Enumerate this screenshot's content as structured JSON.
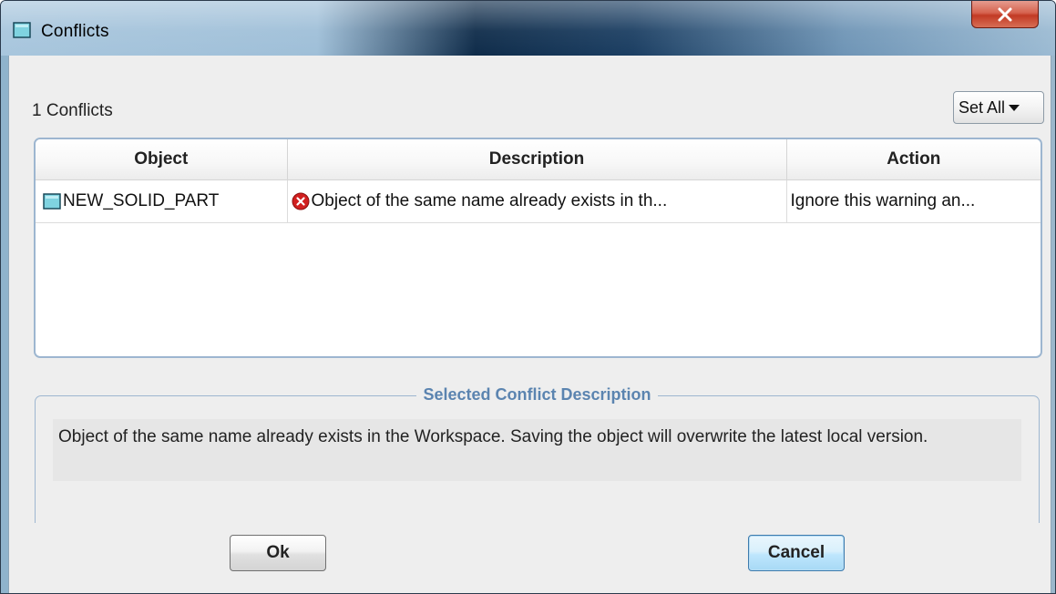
{
  "window": {
    "title": "Conflicts",
    "close_label": "X"
  },
  "header": {
    "count_label": "1 Conflicts",
    "set_all_label": "Set All"
  },
  "table": {
    "columns": [
      "Object",
      "Description",
      "Action"
    ],
    "rows": [
      {
        "object": "NEW_SOLID_PART",
        "object_icon": "part-icon",
        "description": "Object of the same name already exists in th...",
        "description_icon": "error-icon",
        "action": "Ignore this warning an..."
      }
    ]
  },
  "selected_description": {
    "title": "Selected Conflict Description",
    "text": "Object of the same name already exists in the Workspace. Saving the object will overwrite the latest local version."
  },
  "buttons": {
    "ok": "Ok",
    "cancel": "Cancel"
  },
  "colors": {
    "accent": "#5b84b0",
    "error": "#d11f1f",
    "part_icon": "#7fd3e0"
  }
}
